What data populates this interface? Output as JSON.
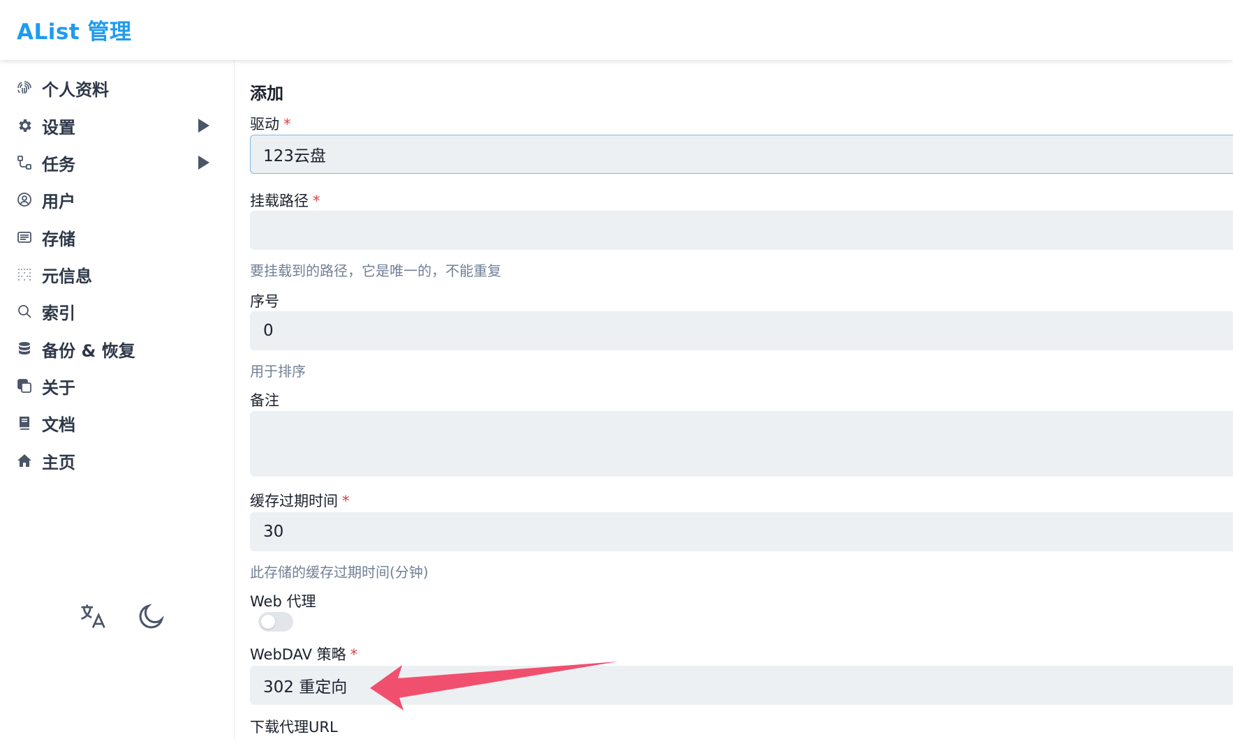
{
  "header": {
    "title": "AList 管理"
  },
  "sidebar": {
    "items": [
      {
        "label": "个人资料",
        "icon": "fingerprint-icon",
        "has_submenu": false
      },
      {
        "label": "设置",
        "icon": "gear-icon",
        "has_submenu": true
      },
      {
        "label": "任务",
        "icon": "flow-icon",
        "has_submenu": true
      },
      {
        "label": "用户",
        "icon": "user-circle-icon",
        "has_submenu": false
      },
      {
        "label": "存储",
        "icon": "storage-list-icon",
        "has_submenu": false
      },
      {
        "label": "元信息",
        "icon": "metadata-icon",
        "has_submenu": false
      },
      {
        "label": "索引",
        "icon": "search-icon",
        "has_submenu": false
      },
      {
        "label": "备份 & 恢复",
        "icon": "database-icon",
        "has_submenu": false
      },
      {
        "label": "关于",
        "icon": "copy-icon",
        "has_submenu": false
      },
      {
        "label": "文档",
        "icon": "book-icon",
        "has_submenu": false
      },
      {
        "label": "主页",
        "icon": "home-icon",
        "has_submenu": false
      }
    ],
    "tools": {
      "language_icon": "translate-icon",
      "theme_icon": "moon-icon"
    }
  },
  "form": {
    "title": "添加",
    "driver": {
      "label": "驱动",
      "required_mark": "*",
      "value": "123云盘"
    },
    "mount_path": {
      "label": "挂载路径",
      "required_mark": "*",
      "value": "",
      "help": "要挂载到的路径，它是唯一的，不能重复"
    },
    "order": {
      "label": "序号",
      "value": "0",
      "help": "用于排序"
    },
    "remark": {
      "label": "备注",
      "value": ""
    },
    "cache_expiration": {
      "label": "缓存过期时间",
      "required_mark": "*",
      "value": "30",
      "help": "此存储的缓存过期时间(分钟)"
    },
    "web_proxy": {
      "label": "Web 代理",
      "enabled": false
    },
    "webdav_policy": {
      "label": "WebDAV 策略",
      "required_mark": "*",
      "value": "302 重定向"
    },
    "download_proxy_url": {
      "label": "下载代理URL"
    }
  },
  "colors": {
    "brand": "#1e9bf0",
    "required": "#e53e3e",
    "annotation_arrow": "#f0506e"
  }
}
